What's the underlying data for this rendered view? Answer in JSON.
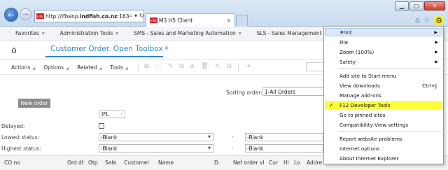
{
  "window": {
    "min": "▁",
    "max": "▢",
    "close": "✕"
  },
  "browser": {
    "back_icon": "←",
    "fwd_icon": "→",
    "address": {
      "prefix": "http://ifbenp.",
      "domain": "indfish.co.nz",
      "suffix": ":163"
    },
    "address_tools": {
      "search": "⌕",
      "dropdown": "▾",
      "refresh": "↻"
    },
    "favicon_text": "infor",
    "tab_title": "M3 H5 Client",
    "tab_close": "✕",
    "home_icon": "⌂",
    "star_icon": "☆",
    "gear_icon": "⚙"
  },
  "menubar": [
    {
      "label": "Favorites",
      "caret": "▾"
    },
    {
      "label": "Administration Tools",
      "caret": "▾"
    },
    {
      "label": "SMS - Sales and Marketing Automation",
      "caret": "▾"
    },
    {
      "label": "SLS - Sales Management",
      "caret": "▾"
    }
  ],
  "page": {
    "home_icon": "⌂",
    "title": "Customer Order. Open Toolbox",
    "title_close": "×"
  },
  "toolbar": {
    "items": [
      {
        "label": "Actions",
        "caret": "◢"
      },
      {
        "label": "Options",
        "caret": "◢"
      },
      {
        "label": "Related",
        "caret": "◢"
      },
      {
        "label": "Tools",
        "caret": "◢"
      }
    ],
    "icons": [
      "⊞",
      "⬚",
      "✎",
      "⧉",
      "⧈",
      "🗑",
      "↻",
      "⊟",
      "⇥"
    ]
  },
  "form": {
    "sorting_label": "Sorting order:",
    "sorting_value": "1-All Orders",
    "new_order": "New order",
    "ifl_value": "IFL",
    "ifl_chevron": "›",
    "delayed_label": "Delayed:",
    "lowest_label": "Lowest status:",
    "highest_label": "Highest status:",
    "blank": "-Blank",
    "dash": "-",
    "arrow": "▼"
  },
  "grid": {
    "columns": [
      "CO no",
      "Ord dt",
      "Otp",
      "Sale",
      "Customer",
      "Name",
      "D.",
      "Net order vl",
      "Cur",
      "Hi",
      "Lo",
      "Addre"
    ]
  },
  "context_menu": {
    "items": [
      {
        "label": "Print",
        "submenu": "▶"
      },
      {
        "label": "File",
        "submenu": "▶"
      },
      {
        "label": "Zoom (100%)",
        "submenu": "▶"
      },
      {
        "label": "Safety",
        "submenu": "▶"
      },
      {
        "label": "Add site to Start menu"
      },
      {
        "label": "View downloads",
        "shortcut": "Ctrl+J"
      },
      {
        "label": "Manage add-ons"
      },
      {
        "label": "F12 Developer Tools",
        "check": "✓"
      },
      {
        "label": "Go to pinned sites"
      },
      {
        "label": "Compatibility View settings"
      },
      {
        "label": "Report website problems"
      },
      {
        "label": "Internet options"
      },
      {
        "label": "About Internet Explorer"
      }
    ]
  }
}
